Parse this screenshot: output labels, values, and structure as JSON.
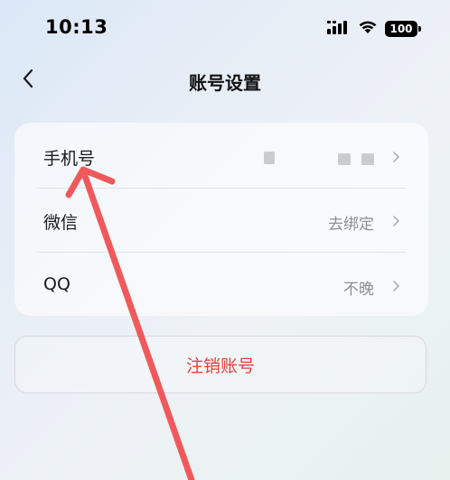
{
  "status_bar": {
    "time": "10:13",
    "battery": "100",
    "icons": [
      "cellular-signal-icon",
      "wifi-icon",
      "battery-icon"
    ]
  },
  "nav": {
    "title": "账号设置",
    "back_icon": "chevron-left-icon"
  },
  "settings": {
    "rows": [
      {
        "label": "手机号",
        "value": ""
      },
      {
        "label": "微信",
        "value": "去绑定"
      },
      {
        "label": "QQ",
        "value": "不晚"
      }
    ]
  },
  "delete_account": {
    "label": "注销账号",
    "color": "#e5413b"
  },
  "annotation": {
    "arrow_color": "#f0595b"
  }
}
